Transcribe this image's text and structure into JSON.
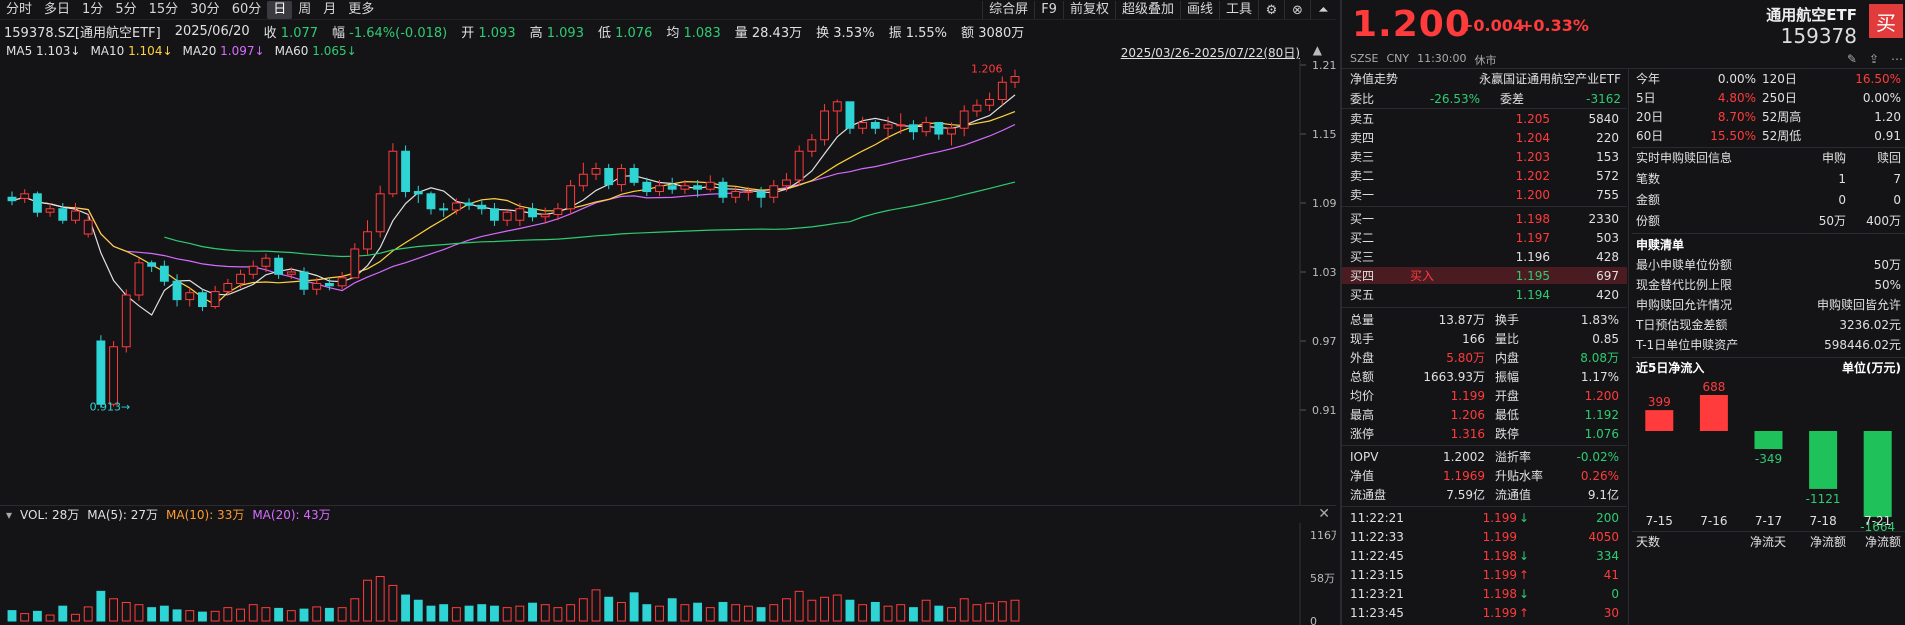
{
  "toolbar": {
    "periods": [
      "分时",
      "多日",
      "1分",
      "5分",
      "15分",
      "30分",
      "60分",
      "日",
      "周",
      "月",
      "更多"
    ],
    "active": "日",
    "right_buttons": [
      "综合屏",
      "F9",
      "前复权",
      "超级叠加",
      "画线",
      "工具"
    ]
  },
  "quote": {
    "code": "159378.SZ[通用航空ETF]",
    "date": "2025/06/20",
    "close_label": "收",
    "close": "1.077",
    "amp_label": "幅",
    "change": "-1.64%(-0.018)",
    "open_label": "开",
    "open": "1.093",
    "high_label": "高",
    "high": "1.093",
    "low_label": "低",
    "low": "1.076",
    "avg_label": "均",
    "avg": "1.083",
    "vol_label": "量",
    "vol": "28.43万",
    "turn_label": "换",
    "turn": "3.53%",
    "swing_label": "振",
    "swing": "1.55%",
    "amount_label": "额",
    "amount": "3080万"
  },
  "ma": [
    {
      "label": "MA5",
      "value": "1.103↓",
      "color": "#e0e0e0"
    },
    {
      "label": "MA10",
      "value": "1.104↓",
      "color": "#ffd23c"
    },
    {
      "label": "MA20",
      "value": "1.097↓",
      "color": "#d76bff"
    },
    {
      "label": "MA60",
      "value": "1.065↓",
      "color": "#2ecc71"
    }
  ],
  "date_range": "2025/03/26-2025/07/22(80日)",
  "price_axis": [
    "1.210",
    "1.150",
    "1.090",
    "1.030",
    "0.970",
    "0.910"
  ],
  "chart_labels": {
    "high": "1.206",
    "low": "0.913"
  },
  "vol_header": {
    "vol": "VOL: 28万",
    "ma5": "MA(5): 27万",
    "ma10": "MA(10): 33万",
    "ma20": "MA(20): 43万"
  },
  "vol_axis": [
    "116万",
    "58万",
    "0"
  ],
  "chart_data": {
    "type": "candlestick",
    "open": [
      1.095,
      1.094,
      1.098,
      1.082,
      1.085,
      1.075,
      1.063,
      0.97,
      0.915,
      0.965,
      1.01,
      1.038,
      1.035,
      1.022,
      1.006,
      1.012,
      1.0,
      1.013,
      1.02,
      1.028,
      1.035,
      1.042,
      1.028,
      1.03,
      1.015,
      1.02,
      1.018,
      1.025,
      1.05,
      1.065,
      1.098,
      1.135,
      1.1,
      1.098,
      1.085,
      1.084,
      1.09,
      1.088,
      1.085,
      1.075,
      1.075,
      1.085,
      1.078,
      1.08,
      1.085,
      1.105,
      1.115,
      1.12,
      1.106,
      1.12,
      1.108,
      1.1,
      1.105,
      1.102,
      1.105,
      1.102,
      1.108,
      1.095,
      1.1,
      1.1,
      1.095,
      1.105,
      1.11,
      1.135,
      1.145,
      1.17,
      1.178,
      1.155,
      1.16,
      1.155,
      1.158,
      1.158,
      1.152,
      1.16,
      1.15,
      1.155,
      1.17,
      1.175,
      1.18,
      1.195
    ],
    "close": [
      1.092,
      1.098,
      1.082,
      1.085,
      1.075,
      1.083,
      1.075,
      0.915,
      0.965,
      1.01,
      1.038,
      1.035,
      1.022,
      1.006,
      1.012,
      1.0,
      1.013,
      1.02,
      1.028,
      1.035,
      1.042,
      1.028,
      1.03,
      1.015,
      1.02,
      1.018,
      1.025,
      1.05,
      1.065,
      1.098,
      1.135,
      1.1,
      1.098,
      1.085,
      1.084,
      1.09,
      1.088,
      1.085,
      1.075,
      1.082,
      1.085,
      1.078,
      1.08,
      1.085,
      1.105,
      1.115,
      1.12,
      1.106,
      1.12,
      1.108,
      1.1,
      1.105,
      1.102,
      1.105,
      1.102,
      1.108,
      1.095,
      1.1,
      1.1,
      1.095,
      1.105,
      1.11,
      1.135,
      1.145,
      1.17,
      1.178,
      1.155,
      1.16,
      1.155,
      1.158,
      1.158,
      1.152,
      1.16,
      1.15,
      1.155,
      1.17,
      1.175,
      1.18,
      1.195,
      1.2
    ],
    "high": [
      1.1,
      1.102,
      1.1,
      1.09,
      1.09,
      1.09,
      1.08,
      0.975,
      0.97,
      1.015,
      1.042,
      1.04,
      1.04,
      1.028,
      1.016,
      1.015,
      1.018,
      1.024,
      1.032,
      1.04,
      1.046,
      1.045,
      1.034,
      1.034,
      1.025,
      1.024,
      1.03,
      1.055,
      1.075,
      1.105,
      1.142,
      1.14,
      1.105,
      1.1,
      1.09,
      1.094,
      1.094,
      1.092,
      1.09,
      1.085,
      1.09,
      1.09,
      1.086,
      1.09,
      1.11,
      1.125,
      1.125,
      1.124,
      1.124,
      1.124,
      1.112,
      1.11,
      1.112,
      1.11,
      1.11,
      1.114,
      1.112,
      1.104,
      1.104,
      1.104,
      1.11,
      1.116,
      1.14,
      1.15,
      1.176,
      1.18,
      1.178,
      1.165,
      1.162,
      1.165,
      1.168,
      1.162,
      1.165,
      1.16,
      1.16,
      1.175,
      1.18,
      1.186,
      1.2,
      1.206
    ],
    "low": [
      1.088,
      1.09,
      1.078,
      1.078,
      1.072,
      1.072,
      1.06,
      0.912,
      0.913,
      0.96,
      1.005,
      1.03,
      1.018,
      1.0,
      1.0,
      0.996,
      0.998,
      1.01,
      1.016,
      1.024,
      1.03,
      1.024,
      1.024,
      1.01,
      1.01,
      1.014,
      1.015,
      1.045,
      1.045,
      1.06,
      1.095,
      1.095,
      1.09,
      1.08,
      1.078,
      1.08,
      1.084,
      1.08,
      1.07,
      1.07,
      1.07,
      1.074,
      1.072,
      1.075,
      1.08,
      1.1,
      1.11,
      1.102,
      1.1,
      1.105,
      1.096,
      1.096,
      1.098,
      1.098,
      1.095,
      1.1,
      1.09,
      1.09,
      1.092,
      1.086,
      1.09,
      1.1,
      1.105,
      1.13,
      1.14,
      1.15,
      1.15,
      1.15,
      1.15,
      1.145,
      1.15,
      1.145,
      1.148,
      1.145,
      1.14,
      1.148,
      1.165,
      1.17,
      1.175,
      1.19
    ],
    "volume": [
      14,
      10,
      13,
      8,
      20,
      9,
      19,
      40,
      30,
      25,
      22,
      18,
      20,
      15,
      14,
      12,
      13,
      18,
      16,
      22,
      18,
      17,
      14,
      16,
      19,
      17,
      18,
      30,
      55,
      60,
      48,
      35,
      28,
      20,
      22,
      18,
      20,
      22,
      20,
      18,
      20,
      24,
      22,
      18,
      22,
      30,
      42,
      32,
      25,
      38,
      22,
      20,
      30,
      22,
      24,
      18,
      25,
      22,
      20,
      18,
      22,
      30,
      40,
      28,
      32,
      35,
      28,
      22,
      25,
      20,
      22,
      18,
      28,
      20,
      18,
      30,
      22,
      24,
      26,
      28
    ],
    "ma5": [],
    "ylim": [
      0.91,
      1.21
    ]
  },
  "etf": {
    "price": "1.200",
    "change": "+0.004",
    "change_pct": "+0.33%",
    "name": "通用航空ETF",
    "code": "159378",
    "buy": "买",
    "market": "SZSE",
    "currency": "CNY",
    "time": "11:30:00",
    "status": "休市"
  },
  "nav_row": {
    "label": "净值走势",
    "name": "永赢国证通用航空产业ETF"
  },
  "weibi": {
    "label1": "委比",
    "val1": "-26.53%",
    "label2": "委差",
    "val2": "-3162"
  },
  "asks": [
    {
      "label": "卖五",
      "price": "1.205",
      "vol": "5840",
      "pc": "r"
    },
    {
      "label": "卖四",
      "price": "1.204",
      "vol": "220",
      "pc": "r"
    },
    {
      "label": "卖三",
      "price": "1.203",
      "vol": "153",
      "pc": "r"
    },
    {
      "label": "卖二",
      "price": "1.202",
      "vol": "572",
      "pc": "r"
    },
    {
      "label": "卖一",
      "price": "1.200",
      "vol": "755",
      "pc": "r"
    }
  ],
  "bids": [
    {
      "label": "买一",
      "price": "1.198",
      "vol": "2330",
      "pc": "r",
      "tag": ""
    },
    {
      "label": "买二",
      "price": "1.197",
      "vol": "503",
      "pc": "r",
      "tag": ""
    },
    {
      "label": "买三",
      "price": "1.196",
      "vol": "428",
      "pc": "w",
      "tag": ""
    },
    {
      "label": "买四",
      "price": "1.195",
      "vol": "697",
      "pc": "g",
      "tag": "买入"
    },
    {
      "label": "买五",
      "price": "1.194",
      "vol": "420",
      "pc": "g",
      "tag": ""
    }
  ],
  "stats": [
    {
      "l1": "总量",
      "v1": "13.87万",
      "c1": "w",
      "l2": "换手",
      "v2": "1.83%",
      "c2": "w"
    },
    {
      "l1": "现手",
      "v1": "166",
      "c1": "w",
      "l2": "量比",
      "v2": "0.85",
      "c2": "w"
    },
    {
      "l1": "外盘",
      "v1": "5.80万",
      "c1": "r",
      "l2": "内盘",
      "v2": "8.08万",
      "c2": "g"
    },
    {
      "l1": "总额",
      "v1": "1663.93万",
      "c1": "w",
      "l2": "振幅",
      "v2": "1.17%",
      "c2": "w"
    },
    {
      "l1": "均价",
      "v1": "1.199",
      "c1": "r",
      "l2": "开盘",
      "v2": "1.200",
      "c2": "r"
    },
    {
      "l1": "最高",
      "v1": "1.206",
      "c1": "r",
      "l2": "最低",
      "v2": "1.192",
      "c2": "g"
    },
    {
      "l1": "涨停",
      "v1": "1.316",
      "c1": "r",
      "l2": "跌停",
      "v2": "1.076",
      "c2": "g"
    }
  ],
  "iopv": [
    {
      "l1": "IOPV",
      "v1": "1.2002",
      "c1": "w",
      "l2": "溢折率",
      "v2": "-0.02%",
      "c2": "g"
    },
    {
      "l1": "净值",
      "v1": "1.1969",
      "c1": "r",
      "l2": "升贴水率",
      "v2": "0.26%",
      "c2": "r"
    },
    {
      "l1": "流通盘",
      "v1": "7.59亿",
      "c1": "w",
      "l2": "流通值",
      "v2": "9.1亿",
      "c2": "w"
    }
  ],
  "ticks": [
    {
      "t": "11:22:21",
      "p": "1.199",
      "d": "↓",
      "dc": "g",
      "v": "200",
      "vc": "g"
    },
    {
      "t": "11:22:33",
      "p": "1.199",
      "d": "",
      "dc": "r",
      "v": "4050",
      "vc": "r"
    },
    {
      "t": "11:22:45",
      "p": "1.198",
      "d": "↓",
      "dc": "g",
      "v": "334",
      "vc": "g"
    },
    {
      "t": "11:23:15",
      "p": "1.199",
      "d": "↑",
      "dc": "r",
      "v": "41",
      "vc": "r"
    },
    {
      "t": "11:23:21",
      "p": "1.198",
      "d": "↓",
      "dc": "g",
      "v": "0",
      "vc": "g"
    },
    {
      "t": "11:23:45",
      "p": "1.199",
      "d": "↑",
      "dc": "r",
      "v": "30",
      "vc": "r"
    }
  ],
  "perf": [
    {
      "l1": "今年",
      "v1": "0.00%",
      "c1": "w",
      "l2": "120日",
      "v2": "16.50%",
      "c2": "r"
    },
    {
      "l1": "5日",
      "v1": "4.80%",
      "c1": "r",
      "l2": "250日",
      "v2": "0.00%",
      "c2": "w"
    },
    {
      "l1": "20日",
      "v1": "8.70%",
      "c1": "r",
      "l2": "52周高",
      "v2": "1.20",
      "c2": "w"
    },
    {
      "l1": "60日",
      "v1": "15.50%",
      "c1": "r",
      "l2": "52周低",
      "v2": "0.91",
      "c2": "w"
    }
  ],
  "redeem": {
    "title": "实时申购赎回信息",
    "col1": "申购",
    "col2": "赎回",
    "rows": [
      {
        "l": "笔数",
        "a": "1",
        "b": "7"
      },
      {
        "l": "金额",
        "a": "0",
        "b": "0"
      },
      {
        "l": "份额",
        "a": "50万",
        "b": "400万"
      }
    ]
  },
  "subscribe": {
    "title": "申赎清单",
    "rows": [
      {
        "l": "最小申赎单位份额",
        "v": "50万"
      },
      {
        "l": "现金替代比例上限",
        "v": "50%"
      },
      {
        "l": "申购赎回允许情况",
        "v": "申购赎回皆允许"
      },
      {
        "l": "T日预估现金差额",
        "v": "3236.02元"
      },
      {
        "l": "T-1日单位申赎资产",
        "v": "598446.02元"
      }
    ]
  },
  "inflow": {
    "title": "近5日净流入",
    "unit": "单位(万元)",
    "chart_data": {
      "type": "bar",
      "categories": [
        "7-15",
        "7-16",
        "7-17",
        "7-18",
        "7-21"
      ],
      "values": [
        399,
        688,
        -349,
        -1121,
        -1664
      ]
    }
  },
  "bottom": {
    "c1": "天数",
    "c2": "净流天",
    "c3": "净流额",
    "c4": "净流额"
  },
  "colors": {
    "up": "#ff3b3b",
    "down": "#2fd4d4",
    "green": "#2ecc71"
  }
}
